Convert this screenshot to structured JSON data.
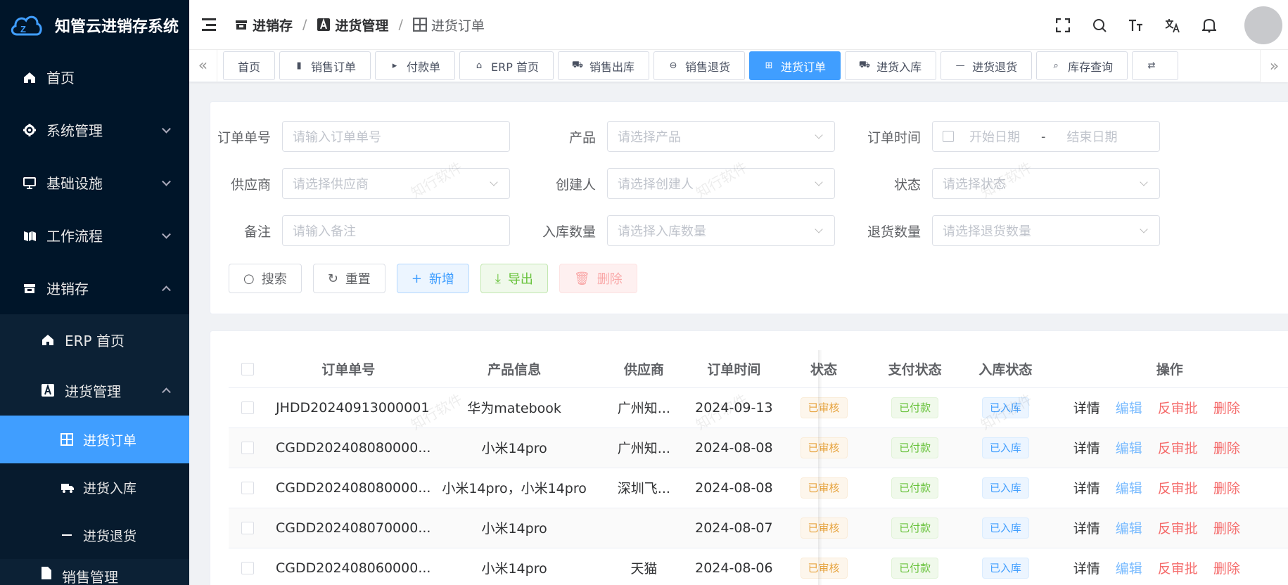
{
  "app": {
    "title": "知管云进销存系统"
  },
  "sidebar": {
    "items": [
      {
        "label": "首页",
        "icon": "home-icon"
      },
      {
        "label": "系统管理",
        "icon": "gear-icon"
      },
      {
        "label": "基础设施",
        "icon": "monitor-icon"
      },
      {
        "label": "工作流程",
        "icon": "flow-icon"
      },
      {
        "label": "进销存",
        "icon": "store-icon"
      }
    ],
    "sub": [
      {
        "label": "ERP 首页",
        "icon": "home-icon"
      },
      {
        "label": "进货管理",
        "icon": "purchase-icon"
      }
    ],
    "subsub": [
      {
        "label": "进货订单",
        "icon": "grid-icon"
      },
      {
        "label": "进货入库",
        "icon": "truck-icon"
      },
      {
        "label": "进货退货",
        "icon": "minus-icon"
      }
    ],
    "next_label": "销售管理"
  },
  "breadcrumb": {
    "items": [
      "进销存",
      "进货管理",
      "进货订单"
    ]
  },
  "tags": [
    "首页",
    "销售订单",
    "付款单",
    "ERP 首页",
    "销售出库",
    "销售退货",
    "进货订单",
    "进货入库",
    "进货退货",
    "库存查询"
  ],
  "form": {
    "order_no": {
      "label": "订单单号",
      "placeholder": "请输入订单单号"
    },
    "product": {
      "label": "产品",
      "placeholder": "请选择产品"
    },
    "order_time": {
      "label": "订单时间",
      "start": "开始日期",
      "sep": "-",
      "end": "结束日期"
    },
    "supplier": {
      "label": "供应商",
      "placeholder": "请选择供应商"
    },
    "creator": {
      "label": "创建人",
      "placeholder": "请选择创建人"
    },
    "status": {
      "label": "状态",
      "placeholder": "请选择状态"
    },
    "remark": {
      "label": "备注",
      "placeholder": "请输入备注"
    },
    "in_qty": {
      "label": "入库数量",
      "placeholder": "请选择入库数量"
    },
    "return_qty": {
      "label": "退货数量",
      "placeholder": "请选择退货数量"
    }
  },
  "buttons": {
    "search": "搜索",
    "reset": "重置",
    "add": "新增",
    "export": "导出",
    "delete": "删除"
  },
  "table": {
    "headers": [
      "订单单号",
      "产品信息",
      "供应商",
      "订单时间",
      "状态",
      "支付状态",
      "入库状态",
      "操作"
    ],
    "rows": [
      {
        "order_no": "JHDD20240913000001",
        "product": "华为matebook",
        "supplier": "广州知...",
        "time": "2024-09-13",
        "status": "已审核",
        "pay": "已付款",
        "in": "已入库"
      },
      {
        "order_no": "CGDD202408080000...",
        "product": "小米14pro",
        "supplier": "广州知...",
        "time": "2024-08-08",
        "status": "已审核",
        "pay": "已付款",
        "in": "已入库"
      },
      {
        "order_no": "CGDD202408080000...",
        "product": "小米14pro，小米14pro",
        "supplier": "深圳飞...",
        "time": "2024-08-08",
        "status": "已审核",
        "pay": "已付款",
        "in": "已入库"
      },
      {
        "order_no": "CGDD202408070000...",
        "product": "小米14pro",
        "supplier": "",
        "time": "2024-08-07",
        "status": "已审核",
        "pay": "已付款",
        "in": "已入库"
      },
      {
        "order_no": "CGDD202408060000...",
        "product": "小米14pro",
        "supplier": "天猫",
        "time": "2024-08-06",
        "status": "已审核",
        "pay": "已付款",
        "in": "已入库"
      }
    ],
    "actions": {
      "detail": "详情",
      "edit": "编辑",
      "reject": "反审批",
      "delete": "删除"
    }
  },
  "watermark": "知行软件",
  "colors": {
    "sidebar": "#001529",
    "accent": "#409eff",
    "active_tag": "#409eff"
  }
}
